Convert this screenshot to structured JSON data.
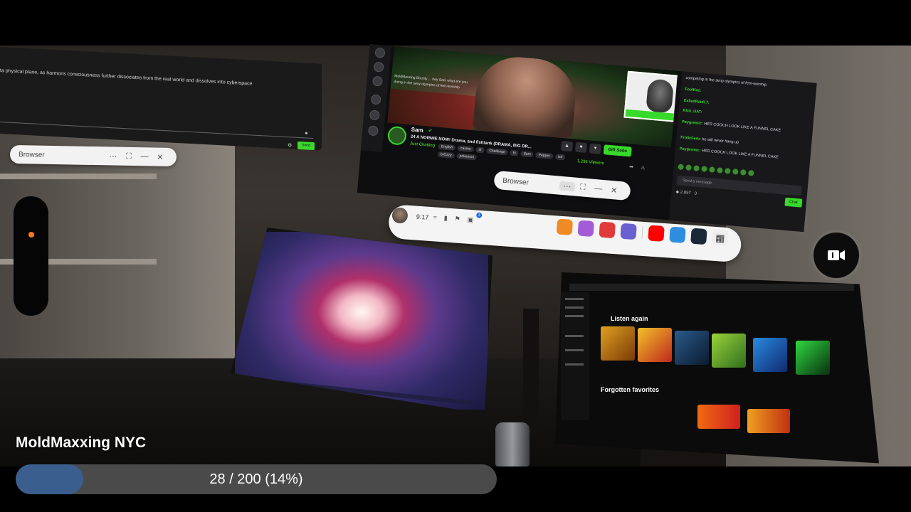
{
  "vpanel": {
    "text": "ta physical plane, as harmons consciousness further dissociates from the real world and dissolves into cyberspace",
    "send_label": "Send"
  },
  "browser_windows": [
    {
      "title": "Browser"
    },
    {
      "title": "Browser"
    }
  ],
  "stream": {
    "streamer": "Sam",
    "title": "24 A NORMIE NOW! Drama, and fishtank (DRAMA, BIG DR...",
    "category": "Just Chatting",
    "tags": [
      "English",
      "casino",
      "irl",
      "Challenge",
      "hi",
      "Sam",
      "Pepper",
      "sol",
      "brOzzy",
      "pokemon"
    ],
    "gift_label": "Gift Subs",
    "viewers": "1,294 Viewers",
    "overlay_text": "MoldMaxxing Bounty ... hey Sam what are you doing in the sexy olympics of fem-worship",
    "chat": [
      {
        "user": "",
        "msg": "competing in the simp olympics of fem-worship"
      },
      {
        "user": "FoolKaz:",
        "msg": ""
      },
      {
        "user": "ExiledRaid17:",
        "msg": ""
      },
      {
        "user": "Klck_UAT:",
        "msg": ""
      },
      {
        "user": "Paygremic:",
        "msg": "HER COOCH LOOK LIKE A FUNNEL CAKE"
      },
      {
        "user": "FrolicFerb:",
        "msg": "he will never hang up"
      },
      {
        "user": "Paygremic:",
        "msg": "HER COOCH LOOK LIKE A FUNNEL CAKE"
      }
    ],
    "chat_placeholder": "Send a message",
    "chat_count": "2,897",
    "chat_points": "0",
    "chat_send": "Chat"
  },
  "taskbar": {
    "time": "9:17",
    "notification_count": "1"
  },
  "music": {
    "listen_again": "Listen again",
    "forgotten_favorites": "Forgotten favorites"
  },
  "location": "MoldMaxxing NYC",
  "progress": {
    "current": 28,
    "total": 200,
    "fraction": 0.14,
    "label": "28 / 200 (14%)"
  },
  "colors": {
    "accent_green": "#37d92a",
    "progress_fill": "#3a5f8f",
    "progress_track": "#4a4a4a",
    "indicator_orange": "#ff7a1a"
  }
}
